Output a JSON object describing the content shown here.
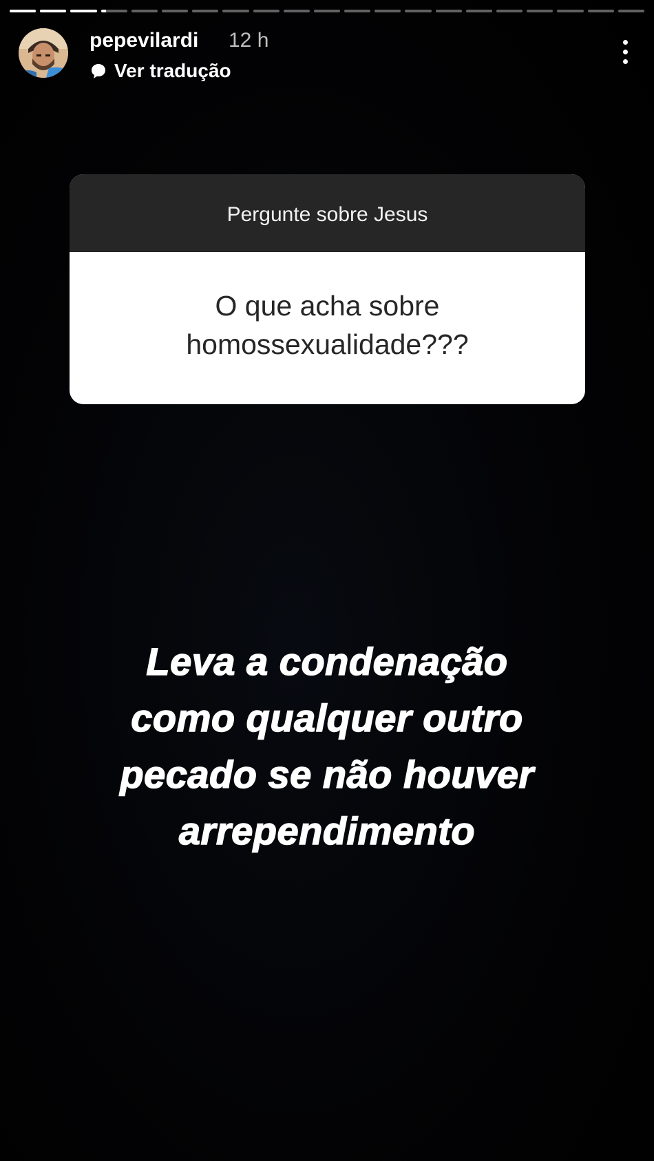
{
  "story": {
    "segments": [
      {
        "progress": 1
      },
      {
        "progress": 1
      },
      {
        "progress": 1
      },
      {
        "progress": 0.2
      },
      {
        "progress": 0
      },
      {
        "progress": 0
      },
      {
        "progress": 0
      },
      {
        "progress": 0
      },
      {
        "progress": 0
      },
      {
        "progress": 0
      },
      {
        "progress": 0
      },
      {
        "progress": 0
      },
      {
        "progress": 0
      },
      {
        "progress": 0
      },
      {
        "progress": 0
      },
      {
        "progress": 0
      },
      {
        "progress": 0
      },
      {
        "progress": 0
      },
      {
        "progress": 0
      },
      {
        "progress": 0
      },
      {
        "progress": 0
      }
    ]
  },
  "header": {
    "username": "pepevilardi",
    "time": "12 h",
    "translate_label": "Ver tradução",
    "translate_icon": "translate-bubble-icon",
    "more_icon": "more-vertical-icon"
  },
  "question": {
    "prompt": "Pergunte sobre Jesus",
    "text": "O que acha sobre homossexualidade???"
  },
  "answer": {
    "lines": [
      "Leva a condenação",
      "como qualquer outro",
      "pecado se não houver",
      "arrependimento"
    ]
  },
  "colors": {
    "background": "#000000",
    "prompt_bar": "#262626",
    "card": "#ffffff",
    "text": "#ffffff"
  }
}
